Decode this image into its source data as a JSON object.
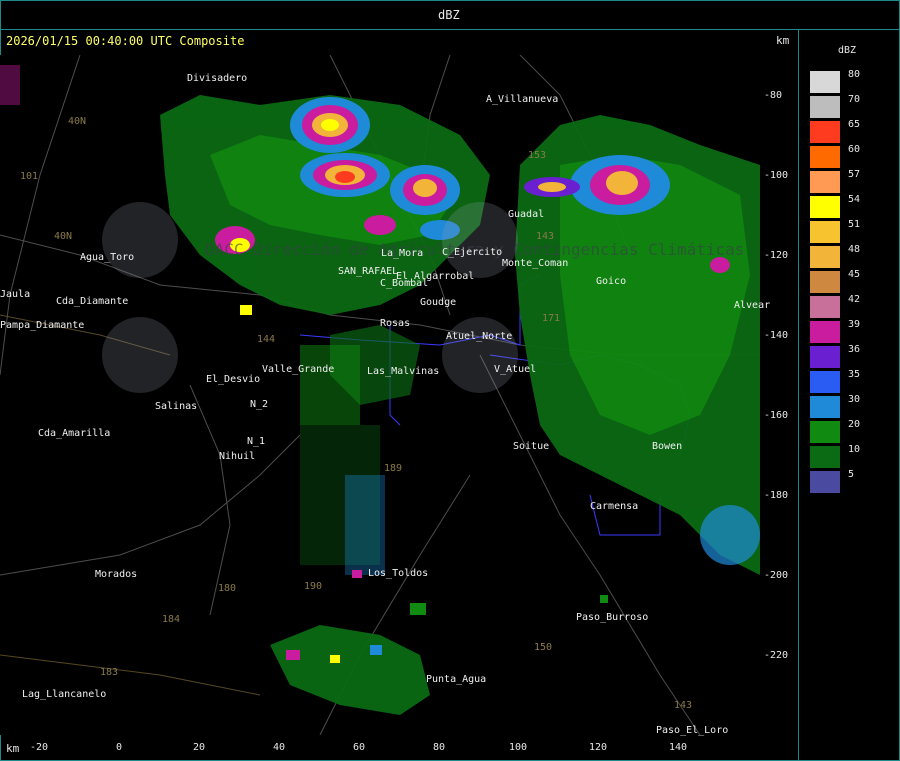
{
  "header": {
    "title": "dBZ"
  },
  "map": {
    "timestamp": "2026/01/15 00:40:00 UTC Composite",
    "km_label_top": "km",
    "km_label_bottom": "km",
    "x_ticks": [
      "-20",
      "0",
      "20",
      "40",
      "60",
      "80",
      "100",
      "120",
      "140"
    ],
    "y_ticks": [
      "-80",
      "-100",
      "-120",
      "-140",
      "-160",
      "-180",
      "-200",
      "-220"
    ],
    "places": [
      "Divisadero",
      "A_Villanueva",
      "Guadal",
      "Agua_Toro",
      "Pampa_Diamante",
      "El_Desvio",
      "Salinas",
      "Cda_Amarilla",
      "Nihuil",
      "N_1",
      "N_2",
      "Valle_Grande",
      "Las_Malvinas",
      "V_Atuel",
      "Soitue",
      "Monte_Coman",
      "C_Ejercito",
      "La_Mora",
      "C_Bombal",
      "El_Algarrobal",
      "SAN_RAFAEL",
      "Goudge",
      "Rosas",
      "Atuel_Norte",
      "Carmensa",
      "Paso_Burroso",
      "Punta_Agua",
      "Los_Toldos",
      "Morados",
      "Lag_Llancanelo",
      "Paso_El_Loro",
      "Alvear",
      "Cda_Diamante",
      "Jaula",
      "Bowen",
      "Goico"
    ],
    "routes": [
      "40N",
      "40N",
      "101",
      "153",
      "171",
      "143",
      "144",
      "180",
      "184",
      "183",
      "143",
      "150",
      "189",
      "190"
    ],
    "watermark": "DACC Dirección de Agricultura y Contingencias Climáticas"
  },
  "legend": {
    "unit": "dBZ",
    "levels": [
      {
        "label": "80",
        "color": "#d8d8d8"
      },
      {
        "label": "70",
        "color": "#bdbdbd"
      },
      {
        "label": "65",
        "color": "#ff3b1f"
      },
      {
        "label": "60",
        "color": "#ff6a00"
      },
      {
        "label": "57",
        "color": "#ff9a55"
      },
      {
        "label": "54",
        "color": "#ffff00"
      },
      {
        "label": "51",
        "color": "#f7c430"
      },
      {
        "label": "48",
        "color": "#f3b43a"
      },
      {
        "label": "45",
        "color": "#cf8840"
      },
      {
        "label": "42",
        "color": "#c8709a"
      },
      {
        "label": "39",
        "color": "#c91c9f"
      },
      {
        "label": "36",
        "color": "#6a1fd0"
      },
      {
        "label": "35",
        "color": "#2a5cf3"
      },
      {
        "label": "30",
        "color": "#1e8ad8"
      },
      {
        "label": "20",
        "color": "#108a10"
      },
      {
        "label": "10",
        "color": "#0b6a14"
      },
      {
        "label": "5",
        "color": "#4a4aa0"
      }
    ]
  }
}
